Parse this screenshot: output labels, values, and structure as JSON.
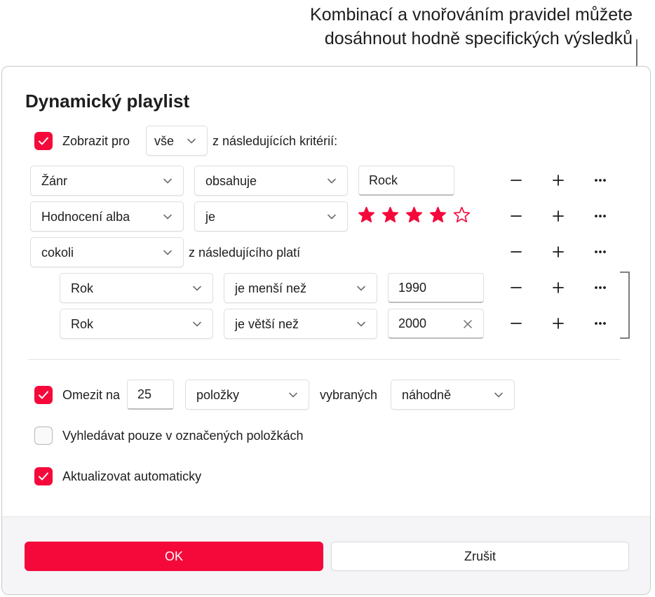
{
  "callout": {
    "line1": "Kombinací a vnořováním pravidel můžete",
    "line2": "dosáhnout hodně specifických výsledků"
  },
  "dialog": {
    "title": "Dynamický playlist",
    "match": {
      "checked": true,
      "prefix": "Zobrazit pro",
      "select": "vše",
      "suffix": "z následujících kritérií:"
    },
    "rules": [
      {
        "field": "Žánr",
        "operator": "obsahuje",
        "value": "Rock"
      },
      {
        "field": "Hodnocení alba",
        "operator": "je",
        "rating": 4,
        "rating_max": 5
      },
      {
        "field": "cokoli",
        "operator_text": "z následujícího platí"
      }
    ],
    "nested_rules": [
      {
        "field": "Rok",
        "operator": "je menší než",
        "value": "1990"
      },
      {
        "field": "Rok",
        "operator": "je větší než",
        "value": "2000"
      }
    ],
    "limit": {
      "checked": true,
      "label": "Omezit na",
      "value": "25",
      "unit": "položky",
      "selected_by_label": "vybraných",
      "selected_by": "náhodně"
    },
    "only_checked": {
      "checked": false,
      "label": "Vyhledávat pouze v označených položkách"
    },
    "live_update": {
      "checked": true,
      "label": "Aktualizovat automaticky"
    },
    "ok_label": "OK",
    "cancel_label": "Zrušit"
  },
  "colors": {
    "accent": "#f5093b",
    "text": "#1d1d1f",
    "footer": "#f5f5f7"
  },
  "icons": {
    "remove": "minus-icon",
    "add": "plus-icon",
    "more": "ellipsis-icon",
    "star": "star-icon",
    "clear": "clear-icon"
  }
}
